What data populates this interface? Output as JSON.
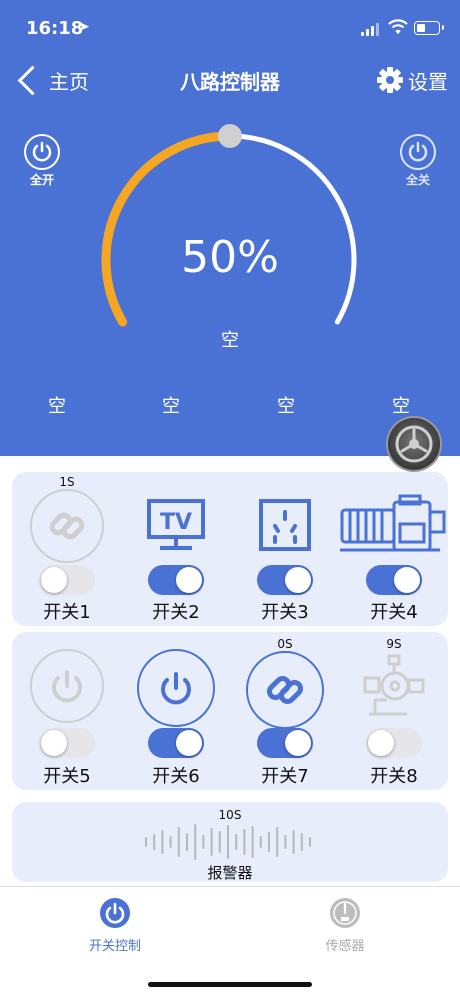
{
  "status_bar": {
    "time": "16:18",
    "location_icon": "location-arrow-icon"
  },
  "nav": {
    "back_label": "主页",
    "title": "八路控制器",
    "settings_label": "设置"
  },
  "master": {
    "all_on_label": "全开",
    "all_off_label": "全关"
  },
  "gauge": {
    "percent_text": "50%",
    "value": 0.5,
    "caption": "空",
    "channels": [
      "空",
      "空",
      "空",
      "空"
    ]
  },
  "colors": {
    "primary": "#4A72D5",
    "arc_active": "#F5A623",
    "card_bg": "#E7EDFB",
    "toggle_off": "#e5e5ea"
  },
  "switches_row1": [
    {
      "timer": "1S",
      "label": "开关1",
      "icon": "link-icon",
      "on": false
    },
    {
      "timer": "",
      "label": "开关2",
      "icon": "tv-icon",
      "on": true
    },
    {
      "timer": "",
      "label": "开关3",
      "icon": "power-outlet-icon",
      "on": true
    },
    {
      "timer": "",
      "label": "开关4",
      "icon": "motor-icon",
      "on": true
    }
  ],
  "switches_row2": [
    {
      "timer": "",
      "label": "开关5",
      "icon": "power-icon",
      "on": false
    },
    {
      "timer": "",
      "label": "开关6",
      "icon": "power-icon",
      "on": true
    },
    {
      "timer": "0S",
      "label": "开关7",
      "icon": "link-icon",
      "on": true
    },
    {
      "timer": "9S",
      "label": "开关8",
      "icon": "pump-icon",
      "on": false
    }
  ],
  "alarm": {
    "timer": "10S",
    "label": "报警器",
    "icon": "sound-wave-icon"
  },
  "tabs": [
    {
      "label": "开关控制",
      "icon": "power-icon",
      "active": true
    },
    {
      "label": "传感器",
      "icon": "gauge-icon",
      "active": false
    }
  ]
}
